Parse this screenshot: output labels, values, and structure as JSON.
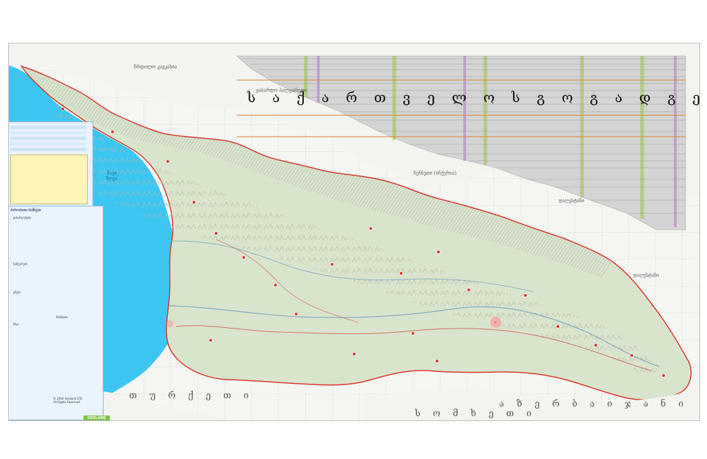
{
  "map": {
    "title": "ს ა ქ ა რ თ ვ ე ლ ო ს   გ ო გ ა დ გ ე ო გ რ ა ფ ი უ ლ ი   რ უ კ ა",
    "neighbor_labels": [
      {
        "text": "ჩრდილო\nკავკასია",
        "name": "north-caucasus-label"
      },
      {
        "text": "ყაბარდო\nბალყარეთი",
        "name": "kabardino-balkaria-label"
      },
      {
        "text": "ჩეჩნეთი\n(იჩქერია)",
        "name": "chechnya-label"
      },
      {
        "text": "დაღესტანი",
        "name": "dagestan-label"
      },
      {
        "text": "დაღესტანი",
        "name": "dagestan-label-2"
      }
    ],
    "sea": {
      "label": "შავი\nზღვა"
    },
    "countries": [
      {
        "text": "თ უ რ ქ ე თ ი",
        "name": "turkey-label"
      },
      {
        "text": "ს ო მ ხ ე თ ი",
        "name": "armenia-label"
      },
      {
        "text": "ა ზ ე რ ბ ა ი ჯ ა ნ ი",
        "name": "azerbaijan-label"
      }
    ],
    "legend": {
      "title": "პირობითი ნიშნები",
      "sections": [
        "დასახლებები",
        "საზღვრები",
        "გზები",
        "სხვა"
      ],
      "scale_title": "მასშტაბი",
      "copyright": "© 2016 Geoland LTD\nAll Rights Reserved",
      "logo": "GEOLAND"
    },
    "colors": {
      "sea": "#3ec6f2",
      "land": "#d9e4cc",
      "border": "#d8352a",
      "hatch": "#9aa0a0",
      "table": "#cfcfcf"
    }
  }
}
